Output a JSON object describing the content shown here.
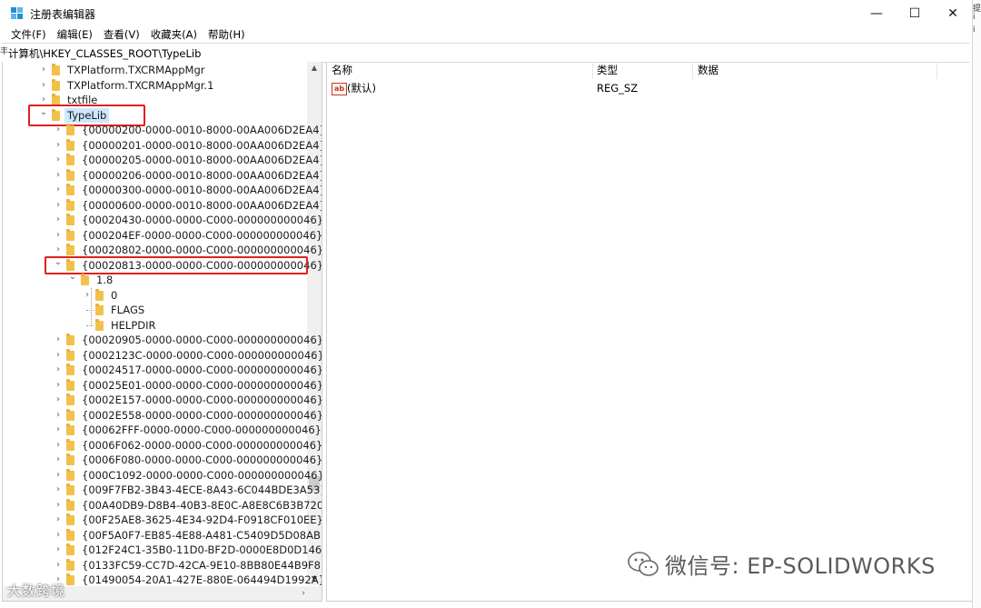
{
  "window": {
    "title": "注册表编辑器",
    "controls": {
      "minimize": "—",
      "maximize": "☐",
      "close": "✕"
    }
  },
  "menu": [
    "文件(F)",
    "编辑(E)",
    "查看(V)",
    "收藏夹(A)",
    "帮助(H)"
  ],
  "address": "计算机\\HKEY_CLASSES_ROOT\\TypeLib",
  "tree": {
    "top_items": [
      "TXPlatform.TXCRMAppMgr",
      "TXPlatform.TXCRMAppMgr.1",
      "txtfile"
    ],
    "selected": "TypeLib",
    "typelib_children_before": [
      "{00000200-0000-0010-8000-00AA006D2EA4}",
      "{00000201-0000-0010-8000-00AA006D2EA4}",
      "{00000205-0000-0010-8000-00AA006D2EA4}",
      "{00000206-0000-0010-8000-00AA006D2EA4}",
      "{00000300-0000-0010-8000-00AA006D2EA4}",
      "{00000600-0000-0010-8000-00AA006D2EA4}",
      "{00020430-0000-0000-C000-000000000046}",
      "{000204EF-0000-0000-C000-000000000046}",
      "{00020802-0000-0000-C000-000000000046}"
    ],
    "expanded_key": "{00020813-0000-0000-C000-000000000046}",
    "version_key": "1.8",
    "version_children": [
      "0",
      "FLAGS",
      "HELPDIR"
    ],
    "typelib_children_after": [
      "{00020905-0000-0000-C000-000000000046}",
      "{0002123C-0000-0000-C000-000000000046}",
      "{00024517-0000-0000-C000-000000000046}",
      "{00025E01-0000-0000-C000-000000000046}",
      "{0002E157-0000-0000-C000-000000000046}",
      "{0002E558-0000-0000-C000-000000000046}",
      "{00062FFF-0000-0000-C000-000000000046}",
      "{0006F062-0000-0000-C000-000000000046}",
      "{0006F080-0000-0000-C000-000000000046}",
      "{000C1092-0000-0000-C000-000000000046}",
      "{009F7FB2-3B43-4ECE-8A43-6C044BDE3A53}",
      "{00A40DB9-D8B4-40B3-8E0C-A8E8C6B3B720}",
      "{00F25AE8-3625-4E34-92D4-F0918CF010EE}",
      "{00F5A0F7-EB85-4E88-A481-C5409D5D08AB}",
      "{012F24C1-35B0-11D0-BF2D-0000E8D0D146}",
      "{0133FC59-CC7D-42CA-9E10-8BB80E44B9F8}",
      "{01490054-20A1-427E-880E-064494D1992A}"
    ]
  },
  "values": {
    "headers": [
      "名称",
      "类型",
      "数据"
    ],
    "rows": [
      {
        "name": "(默认)",
        "type": "REG_SZ",
        "data": ""
      }
    ],
    "icon_text": "ab"
  },
  "edge_text": {
    "right_top": [
      "提",
      "i",
      "i"
    ],
    "left": "丰"
  },
  "watermarks": {
    "left": "大数跨境",
    "right": "微信号: EP-SOLIDWORKS"
  }
}
